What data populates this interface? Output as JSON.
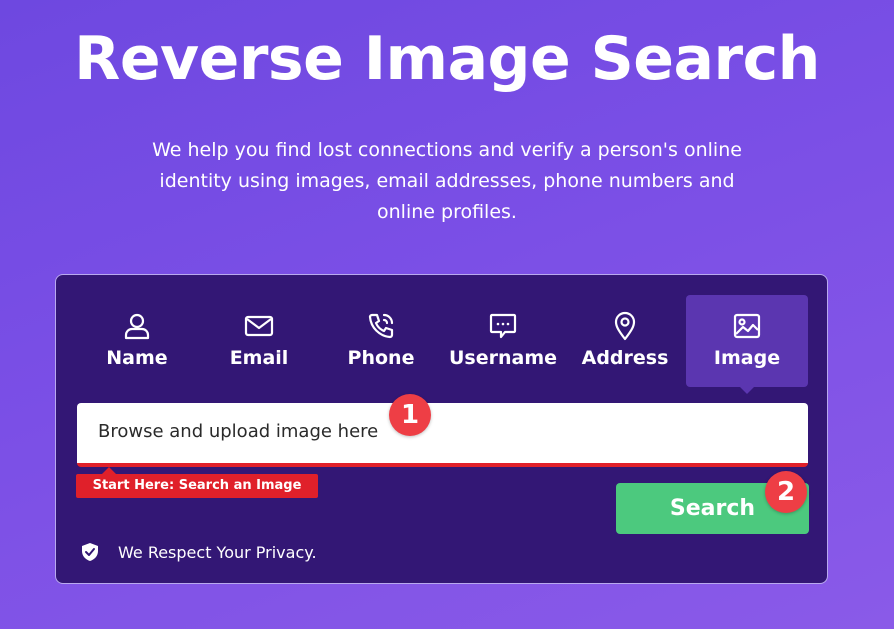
{
  "hero": {
    "title": "Reverse Image Search",
    "subtitle": "We help you find lost connections and verify a person's online identity using images, email addresses, phone numbers and online profiles."
  },
  "tabs": [
    {
      "label": "Name",
      "icon": "person-icon",
      "active": false
    },
    {
      "label": "Email",
      "icon": "envelope-icon",
      "active": false
    },
    {
      "label": "Phone",
      "icon": "phone-icon",
      "active": false
    },
    {
      "label": "Username",
      "icon": "chat-bubble-icon",
      "active": false
    },
    {
      "label": "Address",
      "icon": "location-pin-icon",
      "active": false
    },
    {
      "label": "Image",
      "icon": "image-icon",
      "active": true
    }
  ],
  "upload": {
    "placeholder": "Browse and upload image here"
  },
  "hint": "Start Here: Search an Image",
  "search_label": "Search",
  "steps": [
    "1",
    "2"
  ],
  "privacy": {
    "text": "We Respect Your Privacy.",
    "icon": "shield-check-icon"
  },
  "colors": {
    "panel": "#331775",
    "active_tab": "#5b36b0",
    "search_button": "#4cc97e",
    "alert": "#e0202a",
    "step_badge": "#ee3e45"
  }
}
